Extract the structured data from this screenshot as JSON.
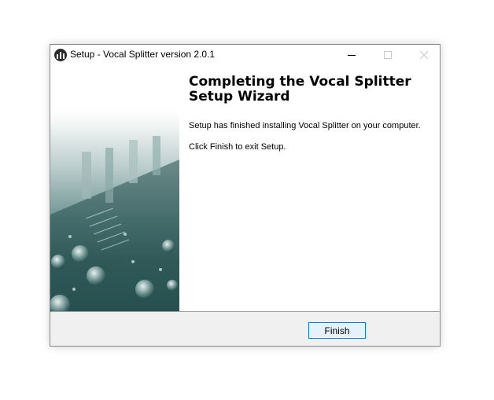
{
  "window": {
    "title": "Setup - Vocal Splitter version 2.0.1",
    "controls": {
      "minimize": "minimize-icon",
      "maximize": "maximize-icon",
      "close": "close-icon"
    }
  },
  "wizard": {
    "heading": "Completing the Vocal Splitter Setup Wizard",
    "message": "Setup has finished installing Vocal Splitter on your computer.",
    "instruction": "Click Finish to exit Setup."
  },
  "footer": {
    "finish_label": "Finish"
  },
  "colors": {
    "accent": "#0078d7",
    "sidebar_teal": "#3d6766",
    "footer_bg": "#f0f0f0"
  }
}
